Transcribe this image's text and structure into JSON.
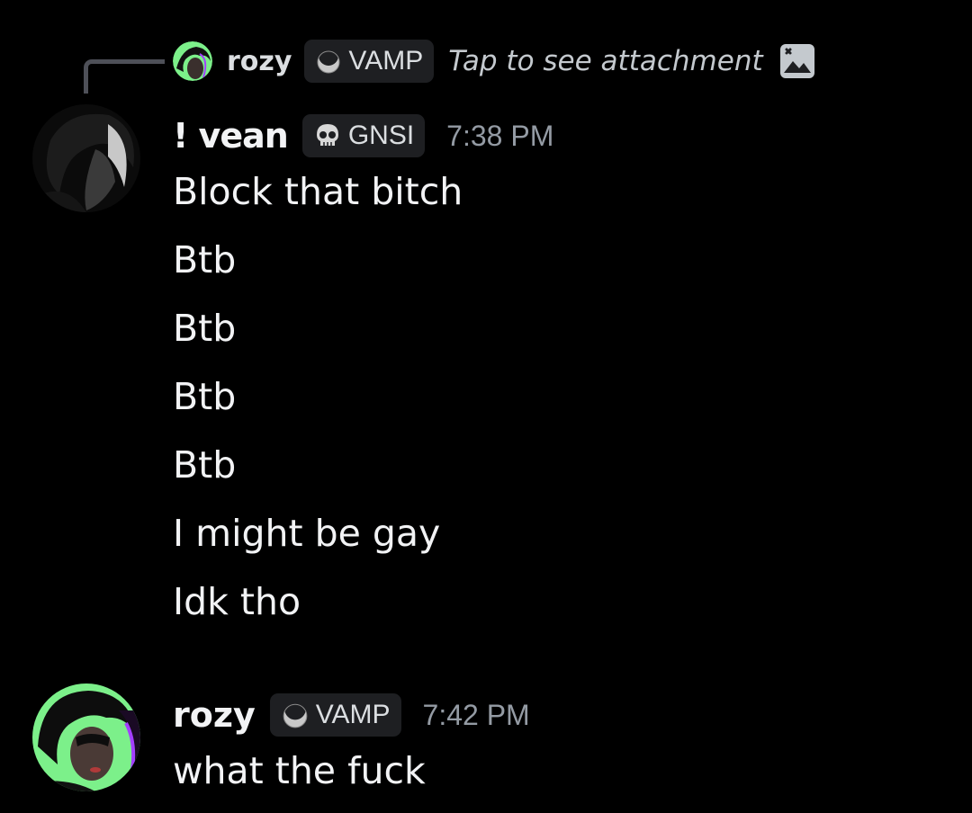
{
  "reply": {
    "author": "rozy",
    "tag": "VAMP",
    "text": "Tap to see attachment",
    "tag_icon": "crescent-moon-icon",
    "attachment_icon": "image-icon"
  },
  "messages": [
    {
      "author": "! vean",
      "tag": "GNSI",
      "tag_icon": "skull-icon",
      "timestamp": "7:38 PM",
      "lines": [
        "Block that bitch",
        "Btb",
        "Btb",
        "Btb",
        "Btb",
        "I might be gay",
        "Idk tho"
      ]
    },
    {
      "author": "rozy",
      "tag": "VAMP",
      "tag_icon": "crescent-moon-icon",
      "timestamp": "7:42 PM",
      "lines": [
        "what the fuck"
      ]
    }
  ],
  "colors": {
    "background": "#000000",
    "text": "#f2f3f5",
    "muted": "#949ba4",
    "badge_bg": "#1e1f22",
    "avatar_green": "#7cf08a"
  }
}
